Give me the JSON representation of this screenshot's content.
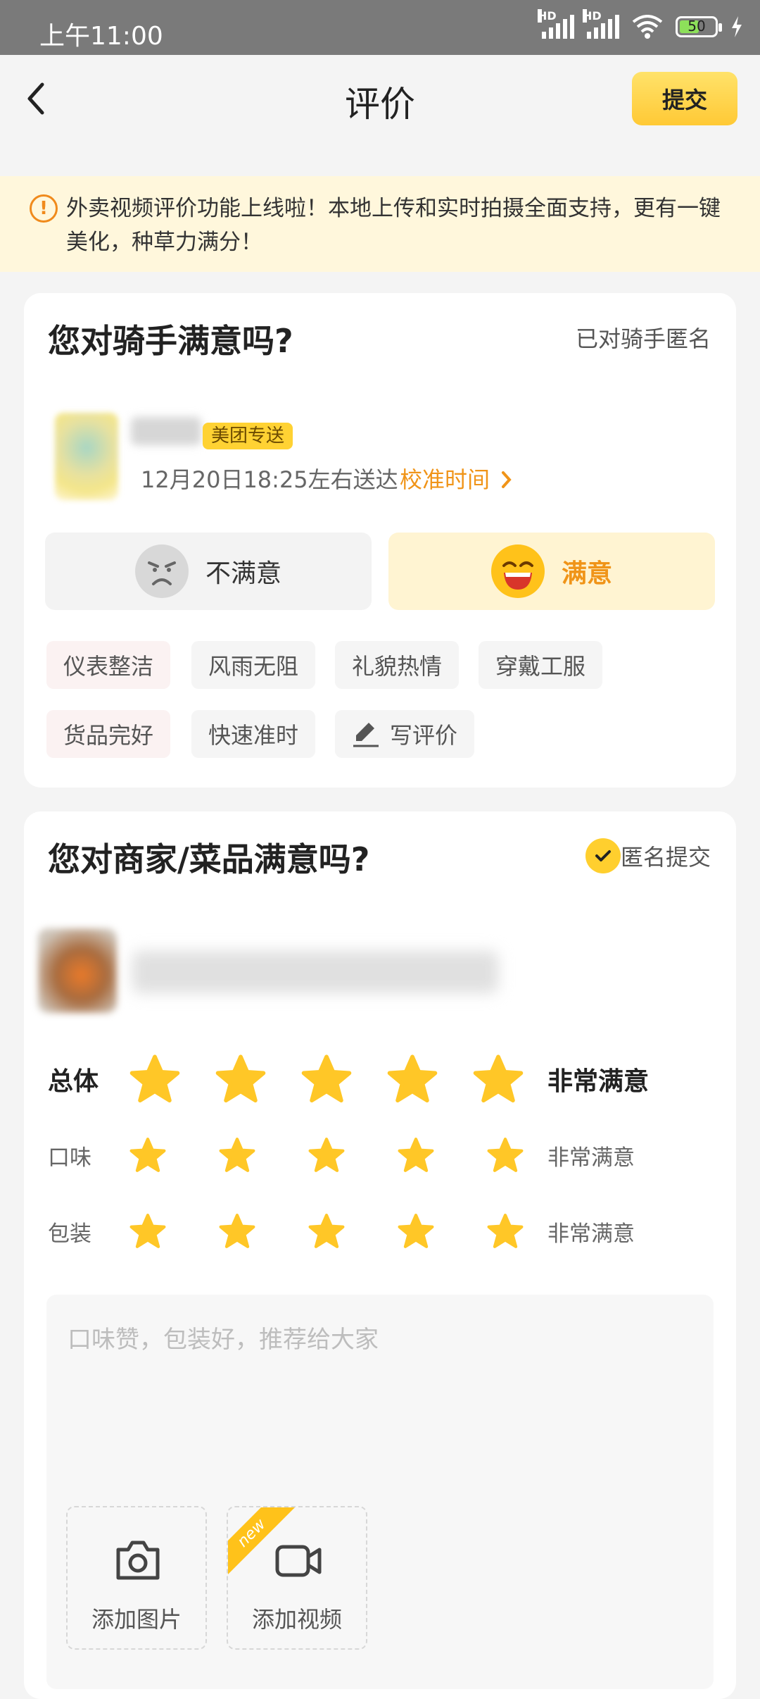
{
  "status_bar": {
    "time": "上午11:00",
    "battery": "50",
    "signal_label": "HD"
  },
  "nav": {
    "title": "评价",
    "submit_label": "提交"
  },
  "notice": {
    "text": "外卖视频评价功能上线啦！本地上传和实时拍摄全面支持，更有一键美化，种草力满分！"
  },
  "rider_section": {
    "title": "您对骑手满意吗?",
    "anonymous_label": "已对骑手匿名",
    "badge": "美团专送",
    "delivery_time": "12月20日18:25左右送达",
    "calibrate_label": "校准时间",
    "dissatisfied_label": "不满意",
    "satisfied_label": "满意",
    "selected": "满意",
    "tags": [
      "仪表整洁",
      "风雨无阻",
      "礼貌热情",
      "穿戴工服",
      "货品完好",
      "快速准时"
    ],
    "write_review_label": "写评价"
  },
  "merchant_section": {
    "title": "您对商家/菜品满意吗?",
    "anonymous_label": "匿名提交",
    "anonymous_checked": true,
    "ratings": [
      {
        "label": "总体",
        "stars": 5,
        "max": 5,
        "text": "非常满意"
      },
      {
        "label": "口味",
        "stars": 5,
        "max": 5,
        "text": "非常满意"
      },
      {
        "label": "包装",
        "stars": 5,
        "max": 5,
        "text": "非常满意"
      }
    ],
    "comment_placeholder": "口味赞，包装好，推荐给大家",
    "add_photo_label": "添加图片",
    "add_video_label": "添加视频",
    "new_badge": "new"
  },
  "colors": {
    "accent": "#ffc21a",
    "orange": "#f09418",
    "notice_bg": "#fff7dc"
  }
}
